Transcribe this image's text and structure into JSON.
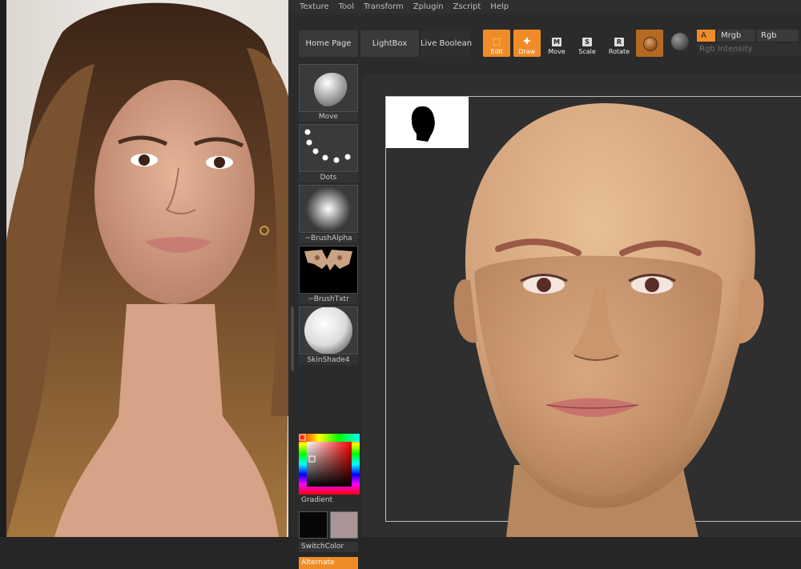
{
  "menubar": {
    "items": [
      "Texture",
      "Tool",
      "Transform",
      "Zplugin",
      "Zscript",
      "Help"
    ]
  },
  "toolbar": {
    "home_page": "Home Page",
    "lightbox": "LightBox",
    "live_boolean": "Live Boolean",
    "edit": "Edit",
    "draw": "Draw",
    "move": "Move",
    "scale": "Scale",
    "rotate": "Rotate",
    "move_glyph": "M",
    "scale_glyph": "S",
    "rotate_glyph": "R",
    "a_label": "A",
    "mrgb": "Mrgb",
    "rgb": "Rgb",
    "rgb_intensity": "Rgb Intensity"
  },
  "palette": {
    "brush": "Move",
    "stroke": "Dots",
    "alpha": "~BrushAlpha",
    "texture": "~BrushTxtr",
    "material": "SkinShade4",
    "gradient": "Gradient",
    "switch_color": "SwitchColor",
    "alternate": "Alternate"
  },
  "colors": {
    "accent": "#f08c28",
    "main_color": "#070707",
    "secondary_color": "#a99596"
  }
}
